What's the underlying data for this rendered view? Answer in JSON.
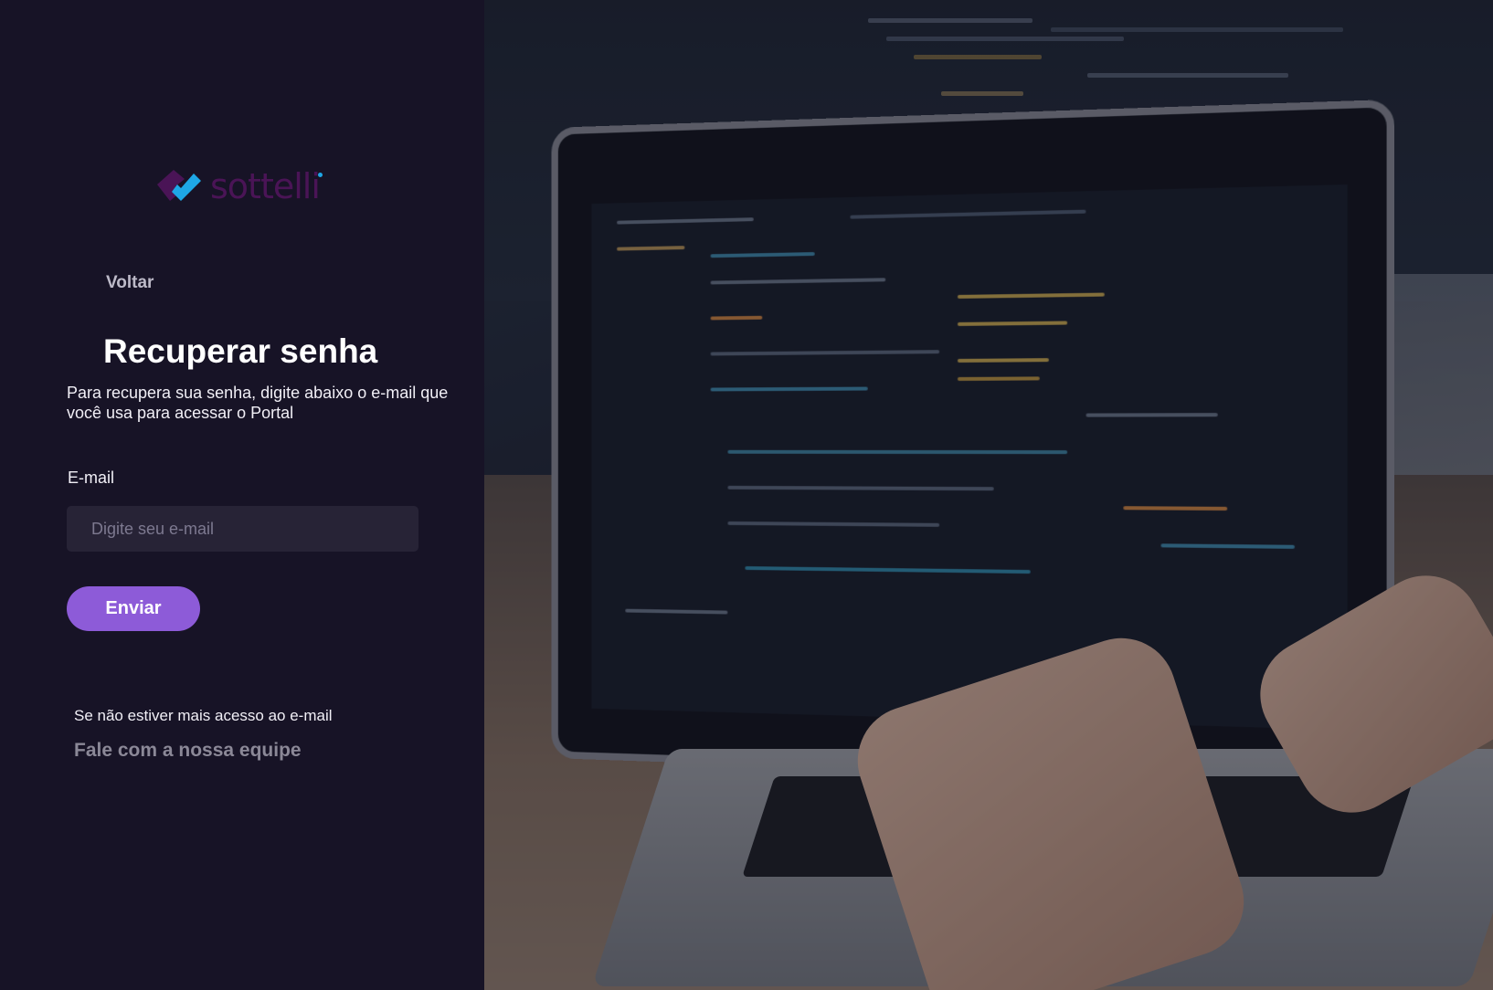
{
  "brand": {
    "logo_text": "sottelli",
    "logo_icon": "sottelli-mark-icon",
    "colors": {
      "mark_purple": "#4a1456",
      "mark_blue": "#1ea7e6"
    }
  },
  "nav": {
    "back_label": "Voltar"
  },
  "form": {
    "title": "Recuperar senha",
    "description": "Para recupera sua senha, digite abaixo o e-mail que você usa para acessar o Portal",
    "email_label": "E-mail",
    "email_placeholder": "Digite seu e-mail",
    "email_value": "",
    "submit_label": "Enviar"
  },
  "help": {
    "text": "Se não estiver mais acesso ao e-mail",
    "link_label": "Fale com a nossa equipe"
  },
  "theme": {
    "panel_bg": "#171326",
    "input_bg": "#272336",
    "button_bg": "#8d5bd8",
    "text_primary": "#ffffff",
    "text_muted": "#8b8897"
  },
  "hero_image": {
    "subject": "laptop-coding-photo"
  }
}
